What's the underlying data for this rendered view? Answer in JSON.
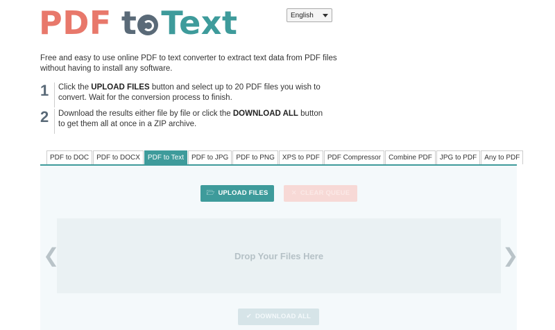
{
  "logo": {
    "pdf": "PDF",
    "to": "t",
    "text": "Text"
  },
  "language": {
    "selected": "English"
  },
  "intro": "Free and easy to use online PDF to text converter to extract text data from PDF files without having to install any software.",
  "steps": [
    {
      "num": "1",
      "before": "Click the ",
      "bold": "UPLOAD FILES",
      "after": " button and select up to 20 PDF files you wish to convert. Wait for the conversion process to finish."
    },
    {
      "num": "2",
      "before": "Download the results either file by file or click the ",
      "bold": "DOWNLOAD ALL",
      "after": " button to get them all at once in a ZIP archive."
    }
  ],
  "tabs": [
    {
      "label": "PDF to DOC"
    },
    {
      "label": "PDF to DOCX"
    },
    {
      "label": "PDF to Text",
      "active": true
    },
    {
      "label": "PDF to JPG"
    },
    {
      "label": "PDF to PNG"
    },
    {
      "label": "XPS to PDF"
    },
    {
      "label": "PDF Compressor"
    },
    {
      "label": "Combine PDF"
    },
    {
      "label": "JPG to PDF"
    },
    {
      "label": "Any to PDF"
    }
  ],
  "buttons": {
    "upload": "UPLOAD FILES",
    "clear": "CLEAR QUEUE",
    "download": "DOWNLOAD ALL"
  },
  "dropzone": {
    "label": "Drop Your Files Here"
  },
  "nav": {
    "prev": "❮",
    "next": "❯"
  },
  "colors": {
    "accent": "#3e9b9b",
    "logo_red": "#e8786b",
    "logo_gray": "#5a6a78"
  }
}
